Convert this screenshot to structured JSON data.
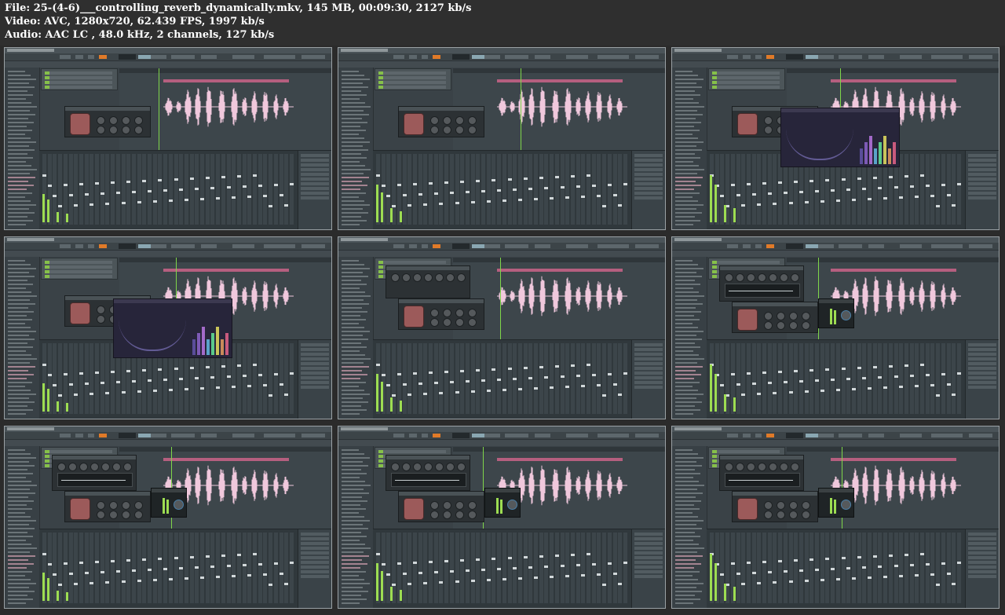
{
  "info": {
    "file_line": "File: 25-(4-6)___controlling_reverb_dynamically.mkv, 145 MB, 00:09:30, 2127 kb/s",
    "video_line": "Video: AVC, 1280x720, 62.439 FPS, 1997 kb/s",
    "audio_line": "Audio: AAC LC , 48.0 kHz, 2 channels, 127 kb/s"
  },
  "colors": {
    "background": "#2b2b2b",
    "waveform": "#f0c8dc",
    "playhead": "#7fd64a",
    "meter": "#9ddd52",
    "tempo_accent": "#e07a28"
  },
  "thumbnails": [
    {
      "popup": "bucket-only"
    },
    {
      "popup": "bucket-only"
    },
    {
      "popup": "eq"
    },
    {
      "popup": "bucket-eq"
    },
    {
      "popup": "knobs"
    },
    {
      "popup": "knobs-limiter"
    },
    {
      "popup": "knobs-limiter"
    },
    {
      "popup": "knobs-limiter"
    },
    {
      "popup": "knobs-limiter"
    }
  ]
}
